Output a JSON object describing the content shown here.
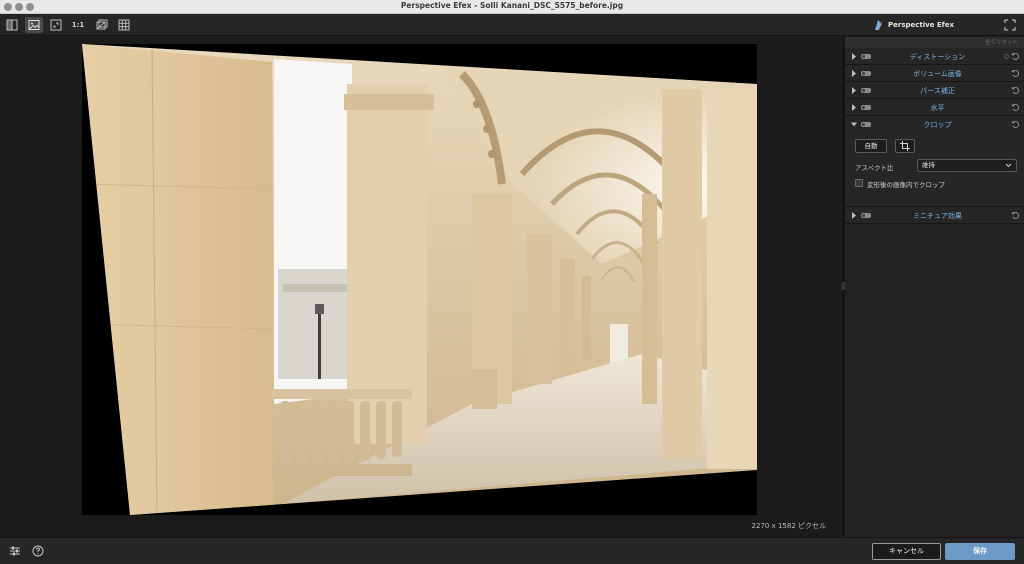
{
  "window": {
    "title": "Perspective Efex - Solli Kanani_DSC_5575_before.jpg"
  },
  "toolbar": {
    "one_to_one_label": "1:1",
    "brand_name": "Perspective Efex"
  },
  "canvas": {
    "dimensions_text": "2270 x 1582 ピクセル"
  },
  "panel": {
    "reset_all_label": "全てリセット",
    "sections": [
      {
        "label": "ディストーション"
      },
      {
        "label": "ボリューム画像"
      },
      {
        "label": "パース補正"
      },
      {
        "label": "水平"
      },
      {
        "label": "クロップ"
      },
      {
        "label": "ミニチュア効果"
      }
    ],
    "crop": {
      "auto_label": "自動",
      "aspect_label": "アスペクト比",
      "aspect_value": "維持",
      "checkbox_label": "変形後の画像内でクロップ"
    }
  },
  "footer": {
    "cancel_label": "キャンセル",
    "save_label": "保存"
  },
  "colors": {
    "accent": "#7fb5e6",
    "save_button": "#6d9bc8"
  }
}
